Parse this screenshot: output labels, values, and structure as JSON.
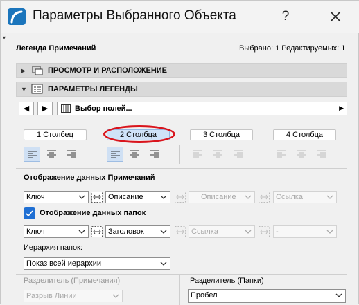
{
  "window": {
    "title": "Параметры Выбранного Объекта",
    "help": "?"
  },
  "header": {
    "left": "Легенда Примечаний",
    "right": "Выбрано: 1 Редактируемых: 1"
  },
  "sections": {
    "view": "ПРОСМОТР И РАСПОЛОЖЕНИЕ",
    "legend": "ПАРАМЕТРЫ ЛЕГЕНДЫ"
  },
  "nav": {
    "field_picker": "Выбор полей..."
  },
  "columns": [
    "1 Столбец",
    "2 Столбца",
    "3 Столбца",
    "4 Столбца"
  ],
  "notes": {
    "heading": "Отображение данных Примечаний",
    "key": "Ключ",
    "desc": "Описание",
    "desc_dis": "Описание",
    "link_dis": "Ссылка"
  },
  "folders": {
    "label": "Отображение данных папок",
    "key": "Ключ",
    "title": "Заголовок",
    "link_dis": "Ссылка",
    "dash_dis": "-"
  },
  "hierarchy": {
    "label": "Иерархия папок:",
    "value": "Показ всей иерархии"
  },
  "separators": {
    "notes_label": "Разделитель (Примечания)",
    "notes_value": "Разрыв Линии",
    "folders_label": "Разделитель (Папки)",
    "folders_value": "Пробел"
  },
  "colors": {
    "accent": "#1f6fd3",
    "annotation": "#d9141c"
  }
}
